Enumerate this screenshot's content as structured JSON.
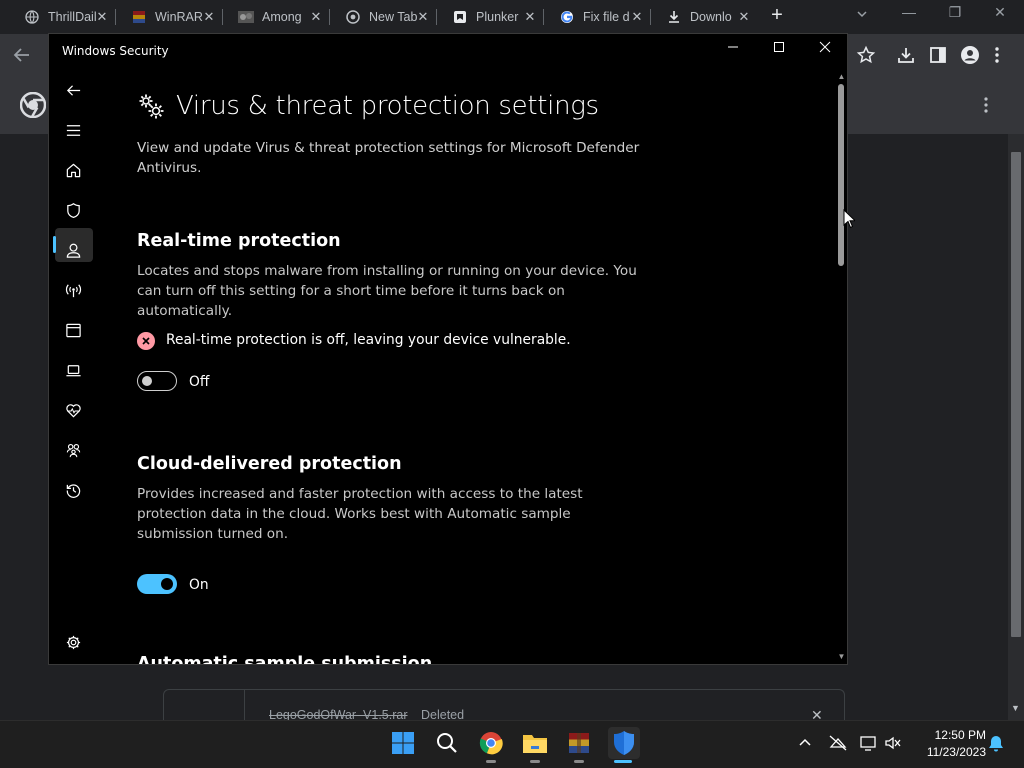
{
  "browser": {
    "tabs": [
      {
        "title": "ThrillDaily",
        "icon": "globe-icon"
      },
      {
        "title": "WinRAR",
        "icon": "winrar-icon"
      },
      {
        "title": "Among",
        "icon": "among-us-icon"
      },
      {
        "title": "New Tab",
        "icon": "chrome-icon"
      },
      {
        "title": "Plunker",
        "icon": "plunker-icon"
      },
      {
        "title": "Fix file d",
        "icon": "google-icon"
      },
      {
        "title": "Downlo",
        "icon": "download-icon"
      }
    ],
    "downloads": {
      "filename": "LegoGodOfWar_V1.5.rar",
      "status": "Deleted"
    }
  },
  "window": {
    "title": "Windows Security"
  },
  "nav": {
    "items": [
      "back",
      "menu",
      "home",
      "virus-threat-protection",
      "account-protection",
      "firewall-network",
      "app-browser-control",
      "device-security",
      "device-performance",
      "family-options",
      "protection-history",
      "settings"
    ],
    "active": "virus-threat-protection"
  },
  "page": {
    "heading": "Virus & threat protection settings",
    "subtitle": "View and update Virus & threat protection settings for Microsoft Defender Antivirus."
  },
  "realtime": {
    "heading": "Real-time protection",
    "description": "Locates and stops malware from installing or running on your device. You can turn off this setting for a short time before it turns back on automatically.",
    "warning": "Real-time protection is off, leaving your device vulnerable.",
    "toggle_state": "Off",
    "warning_color": "#ff99a4"
  },
  "cloud": {
    "heading": "Cloud-delivered protection",
    "description": "Provides increased and faster protection with access to the latest protection data in the cloud. Works best with Automatic sample submission turned on.",
    "toggle_state": "On",
    "accent_color": "#4cc2ff"
  },
  "next_section": {
    "heading": "Automatic sample submission"
  },
  "taskbar": {
    "apps": [
      "start-icon",
      "search-icon",
      "chrome-icon",
      "file-explorer-icon",
      "winrar-icon",
      "windows-security-icon"
    ],
    "time": "12:50 PM",
    "date": "11/23/2023"
  }
}
